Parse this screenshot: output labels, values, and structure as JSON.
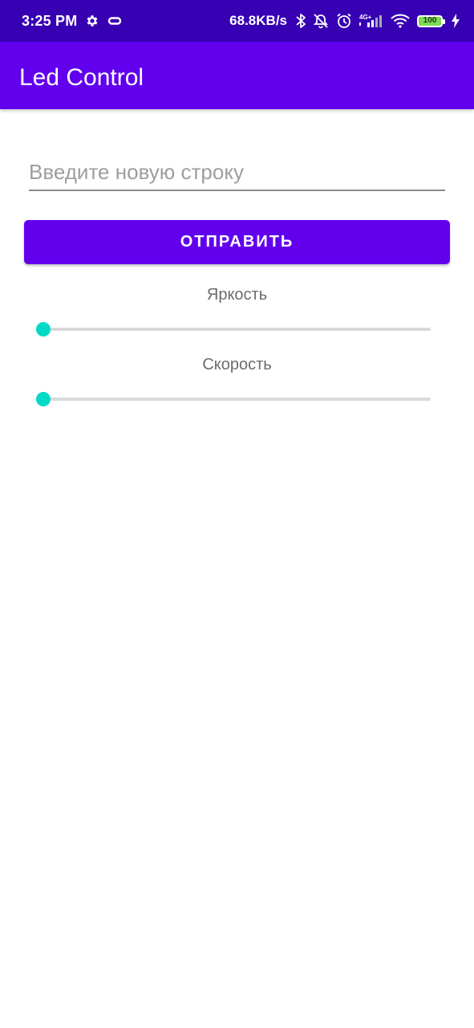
{
  "status_bar": {
    "time": "3:25 PM",
    "network_speed": "68.8KB/s",
    "signal_type": "4G+",
    "battery": "100",
    "icons": [
      "gear-icon",
      "link-icon",
      "bluetooth-icon",
      "notifications-off-icon",
      "alarm-icon",
      "cellular-signal-icon",
      "wifi-icon",
      "battery-icon",
      "charging-icon"
    ]
  },
  "app_bar": {
    "title": "Led Control"
  },
  "form": {
    "input_placeholder": "Введите новую строку",
    "input_value": "",
    "send_label": "ОТПРАВИТЬ"
  },
  "sliders": {
    "brightness": {
      "label": "Яркость",
      "value": 0
    },
    "speed": {
      "label": "Скорость",
      "value": 0
    }
  },
  "colors": {
    "primary": "#6200EE",
    "primary_dark": "#3700B3",
    "accent": "#03DAC5"
  }
}
